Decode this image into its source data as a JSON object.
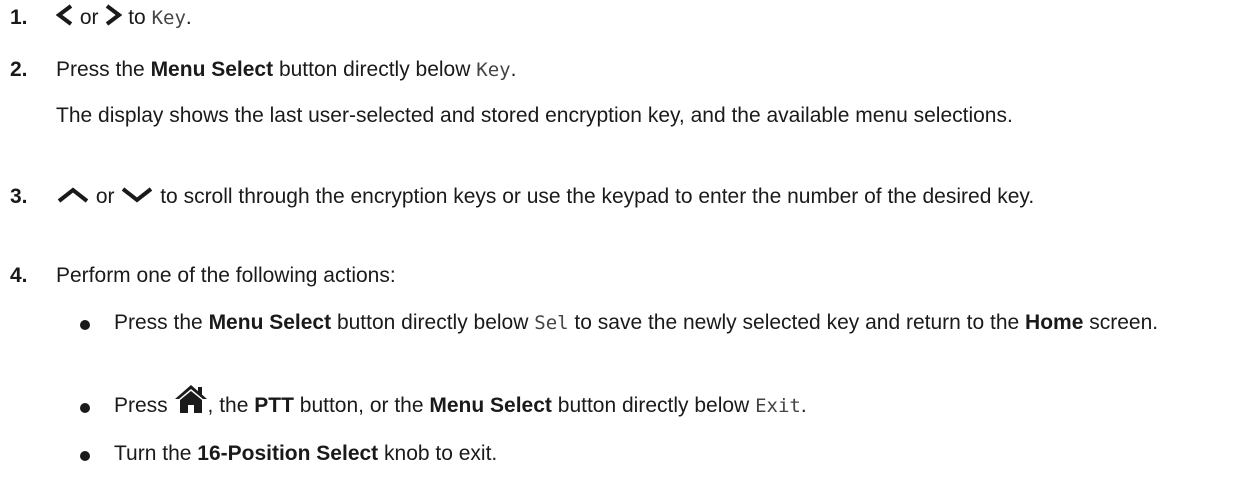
{
  "steps": [
    {
      "num": "1.",
      "or": "or",
      "to": "to",
      "key": "Key",
      "end": "."
    },
    {
      "num": "2.",
      "press": "Press the",
      "menu_select": "Menu Select",
      "below": "button directly below",
      "key": "Key",
      "end": ".",
      "result": "The display shows the last user-selected and stored encryption key, and the available menu selections."
    },
    {
      "num": "3.",
      "or": "or",
      "text": "to scroll through the encryption keys or use the keypad to enter the number of the desired key."
    },
    {
      "num": "4.",
      "text": "Perform one of the following actions:"
    }
  ],
  "bullets": [
    {
      "press": "Press the",
      "menu_select": "Menu Select",
      "below": "button directly below",
      "sel": "Sel",
      "rest": "to save the newly selected key and return to the",
      "home": "Home",
      "screen": "screen."
    },
    {
      "press": "Press",
      "comma_the": ", the",
      "ptt": "PTT",
      "button_or_the": "button, or the",
      "menu_select": "Menu Select",
      "below": "button directly below",
      "exit": "Exit",
      "end": "."
    },
    {
      "turn": "Turn the",
      "knob_name": "16-Position Select",
      "rest": "knob to exit."
    }
  ],
  "icons": {
    "left": "chevron-left-icon",
    "right": "chevron-right-icon",
    "up": "chevron-up-icon",
    "down": "chevron-down-icon",
    "home": "home-icon"
  }
}
